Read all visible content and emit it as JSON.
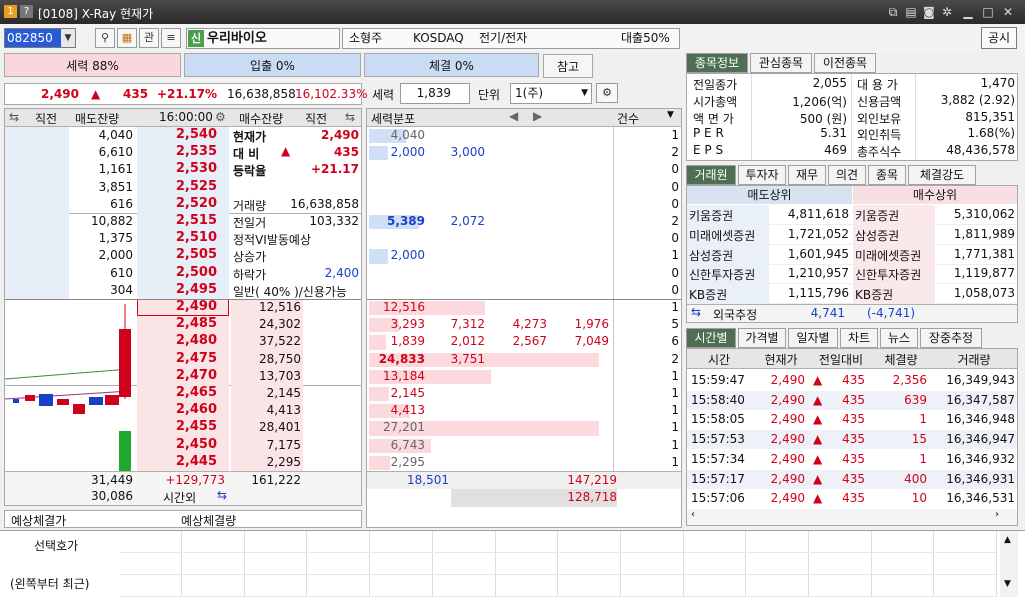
{
  "window": {
    "title": "[0108] X-Ray 현재가",
    "left_icons": [
      "1",
      "?"
    ]
  },
  "toolbar": {
    "code": "082850",
    "gwan": "관",
    "name_badge": "신",
    "name": "우리바이오",
    "size": "소형주",
    "market": "KOSDAQ",
    "sector": "전기/전자",
    "margin": "대출50%",
    "gongsi": "공시"
  },
  "strength": {
    "sell": "세력 88%",
    "in": "입출 0%",
    "exec": "체결 0%",
    "ref": "참고"
  },
  "quote": {
    "price": "2,490",
    "arrow": "▲",
    "change": "435",
    "rate": "+21.17%",
    "volume": "16,638,858",
    "vol_rate": "16,102.33%"
  },
  "filter": {
    "label": "세력",
    "value": "1,839",
    "unit_label": "단위",
    "unit": "1(주)",
    "dist": "세력분포",
    "count": "건수"
  },
  "orderbook": {
    "headers": {
      "prev": "직전",
      "sell_rem": "매도잔량",
      "time": "16:00:00",
      "buy_rem": "매수잔량",
      "prev2": "직전"
    },
    "asks": [
      {
        "vol": "4,040",
        "price": "2,540"
      },
      {
        "vol": "6,610",
        "price": "2,535"
      },
      {
        "vol": "1,161",
        "price": "2,530"
      },
      {
        "vol": "3,851",
        "price": "2,525"
      },
      {
        "vol": "616",
        "price": "2,520"
      },
      {
        "vol": "10,882",
        "price": "2,515"
      },
      {
        "vol": "1,375",
        "price": "2,510"
      },
      {
        "vol": "2,000",
        "price": "2,505"
      },
      {
        "vol": "610",
        "price": "2,500"
      },
      {
        "vol": "304",
        "price": "2,495"
      }
    ],
    "bids": [
      {
        "price": "2,490",
        "vol": "12,516"
      },
      {
        "price": "2,485",
        "vol": "24,302"
      },
      {
        "price": "2,480",
        "vol": "37,522"
      },
      {
        "price": "2,475",
        "vol": "28,750"
      },
      {
        "price": "2,470",
        "vol": "13,703"
      },
      {
        "price": "2,465",
        "vol": "2,145"
      },
      {
        "price": "2,460",
        "vol": "4,413"
      },
      {
        "price": "2,455",
        "vol": "28,401"
      },
      {
        "price": "2,450",
        "vol": "7,175"
      },
      {
        "price": "2,445",
        "vol": "2,295"
      }
    ],
    "info": [
      {
        "k": "현재가",
        "v": "2,490"
      },
      {
        "k": "대 비",
        "a": "▲",
        "v": "435"
      },
      {
        "k": "등락율",
        "v": "+21.17"
      },
      {
        "k": "",
        "v": ""
      },
      {
        "k": "거래량",
        "v": "16,638,858"
      },
      {
        "k": "전일거",
        "v": "103,332"
      },
      {
        "k": "정적VI발동예상",
        "v": ""
      },
      {
        "k": "상승가",
        "v": ""
      },
      {
        "k": "하락가",
        "v": "2,400"
      },
      {
        "k": "일반( 40% )/신용가능",
        "v": ""
      }
    ],
    "total_sell": "31,449",
    "total_diff": "+129,773",
    "total_buy": "161,222",
    "after_sell": "30,086",
    "after_label": "시간외",
    "expected_price": "예상체결가",
    "expected_vol": "예상체결량"
  },
  "dist": {
    "asks": [
      {
        "a": "4,040",
        "n": "1"
      },
      {
        "a": "2,000",
        "b": "3,000",
        "n": "2"
      },
      {
        "n": "0"
      },
      {
        "n": "0"
      },
      {
        "n": "0"
      },
      {
        "a": "5,389",
        "b": "2,072",
        "n": "2"
      },
      {
        "n": "0"
      },
      {
        "a": "2,000",
        "n": "1"
      },
      {
        "n": "0"
      },
      {
        "n": "0"
      }
    ],
    "bids": [
      {
        "a": "12,516",
        "n": "1"
      },
      {
        "a": "3,293",
        "b": "7,312",
        "c": "4,273",
        "d": "1,976",
        "n": "5"
      },
      {
        "a": "1,839",
        "b": "2,012",
        "c": "2,567",
        "d": "7,049",
        "n": "6"
      },
      {
        "a": "24,833",
        "b": "3,751",
        "n": "2"
      },
      {
        "a": "13,184",
        "n": "1"
      },
      {
        "a": "2,145",
        "n": "1"
      },
      {
        "a": "4,413",
        "n": "1"
      },
      {
        "a": "27,201",
        "n": "1"
      },
      {
        "a": "6,743",
        "n": "1"
      },
      {
        "a": "2,295",
        "n": "1"
      }
    ],
    "sum_left": "18,501",
    "sum_right": "147,219",
    "sum_bottom": "128,718"
  },
  "info_tabs": [
    "종목정보",
    "관심종목",
    "이전종목"
  ],
  "stock_info": [
    {
      "k1": "전일종가",
      "v1": "2,055",
      "k2": "대 용 가",
      "v2": "1,470"
    },
    {
      "k1": "시가총액",
      "v1": "1,206(억)",
      "k2": "신용금액",
      "v2": "3,882  (2.92)"
    },
    {
      "k1": "액 면 가",
      "v1": "500 (원)",
      "k2": "외인보유",
      "v2": "815,351"
    },
    {
      "k1": "P E R",
      "v1": "5.31",
      "k2": "외인취득",
      "v2": "1.68(%)"
    },
    {
      "k1": "E P S",
      "v1": "469",
      "k2": "총주식수",
      "v2": "48,436,578"
    }
  ],
  "broker_tabs": [
    "거래원",
    "투자자",
    "재무",
    "의견",
    "종목",
    "체결강도"
  ],
  "broker": {
    "sell_head": "매도상위",
    "buy_head": "매수상위",
    "rows": [
      {
        "s": "키움증권",
        "sv": "4,811,618",
        "b": "키움증권",
        "bv": "5,310,062"
      },
      {
        "s": "미래에셋증권",
        "sv": "1,721,052",
        "b": "삼성증권",
        "bv": "1,811,989"
      },
      {
        "s": "삼성증권",
        "sv": "1,601,945",
        "b": "미래에셋증권",
        "bv": "1,771,381"
      },
      {
        "s": "신한투자증권",
        "sv": "1,210,957",
        "b": "신한투자증권",
        "bv": "1,119,877"
      },
      {
        "s": "KB증권",
        "sv": "1,115,796",
        "b": "KB증권",
        "bv": "1,058,073"
      }
    ],
    "foreign_label": "외국추정",
    "foreign_v": "4,741",
    "foreign_diff": "(-4,741)"
  },
  "time_tabs": [
    "시간별",
    "가격별",
    "일자별",
    "차트",
    "뉴스",
    "장중추정"
  ],
  "time_table": {
    "headers": [
      "시간",
      "현재가",
      "전일대비",
      "체결량",
      "거래량"
    ],
    "rows": [
      {
        "t": "15:59:47",
        "p": "2,490",
        "d": "435",
        "q": "2,356",
        "v": "16,349,943"
      },
      {
        "t": "15:58:40",
        "p": "2,490",
        "d": "435",
        "q": "639",
        "v": "16,347,587"
      },
      {
        "t": "15:58:05",
        "p": "2,490",
        "d": "435",
        "q": "1",
        "v": "16,346,948"
      },
      {
        "t": "15:57:53",
        "p": "2,490",
        "d": "435",
        "q": "15",
        "v": "16,346,947"
      },
      {
        "t": "15:57:34",
        "p": "2,490",
        "d": "435",
        "q": "1",
        "v": "16,346,932"
      },
      {
        "t": "15:57:17",
        "p": "2,490",
        "d": "435",
        "q": "400",
        "v": "16,346,931"
      },
      {
        "t": "15:57:06",
        "p": "2,490",
        "d": "435",
        "q": "10",
        "v": "16,346,531"
      }
    ]
  },
  "bottom": {
    "label1": "선택호가",
    "label2": "(왼쪽부터 최근)"
  }
}
